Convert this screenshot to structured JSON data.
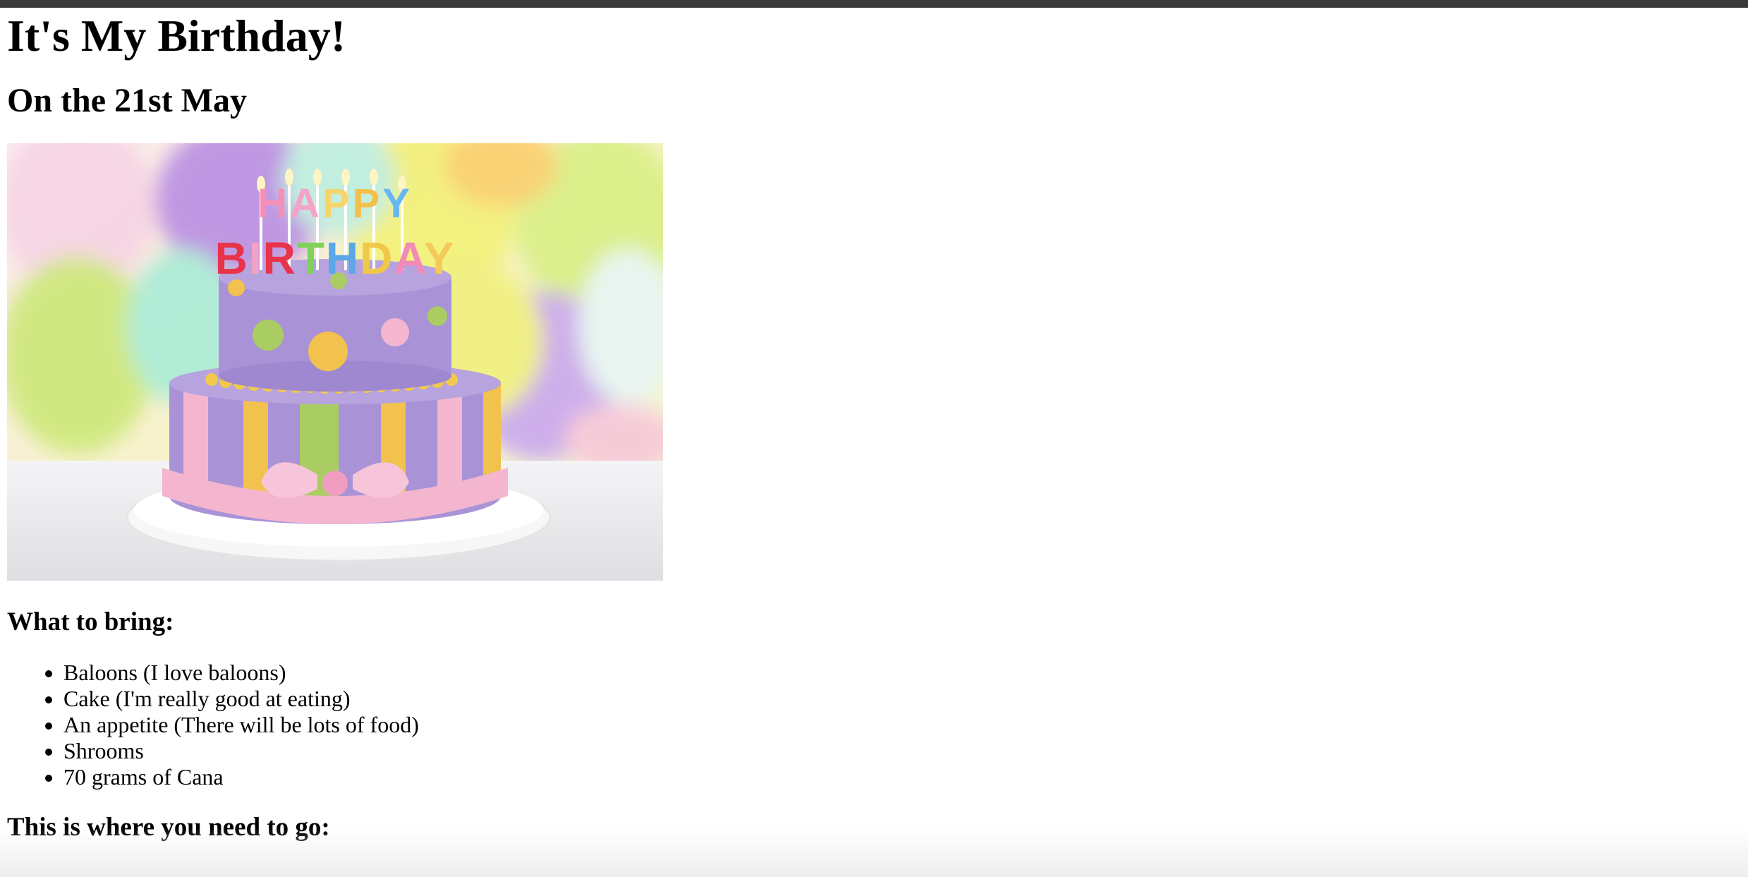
{
  "page": {
    "title": "It's My Birthday!",
    "date_heading": "On the 21st May",
    "cake_image_text": "HAPPY BIRTHDAY",
    "bring_heading": "What to bring:",
    "bring_items": [
      "Baloons (I love baloons)",
      "Cake (I'm really good at eating)",
      "An appetite (There will be lots of food)",
      "Shrooms",
      "70 grams of Cana"
    ],
    "directions_heading": "This is where you need to go:"
  },
  "colors": {
    "topbar": "#3a3a3a",
    "cake_purple": "#a993d6",
    "ribbon_pink": "#f4b6cf",
    "stripe_yellow": "#f2c14e",
    "stripe_green": "#a9cd63"
  },
  "icons": {
    "bullet": "disc"
  }
}
